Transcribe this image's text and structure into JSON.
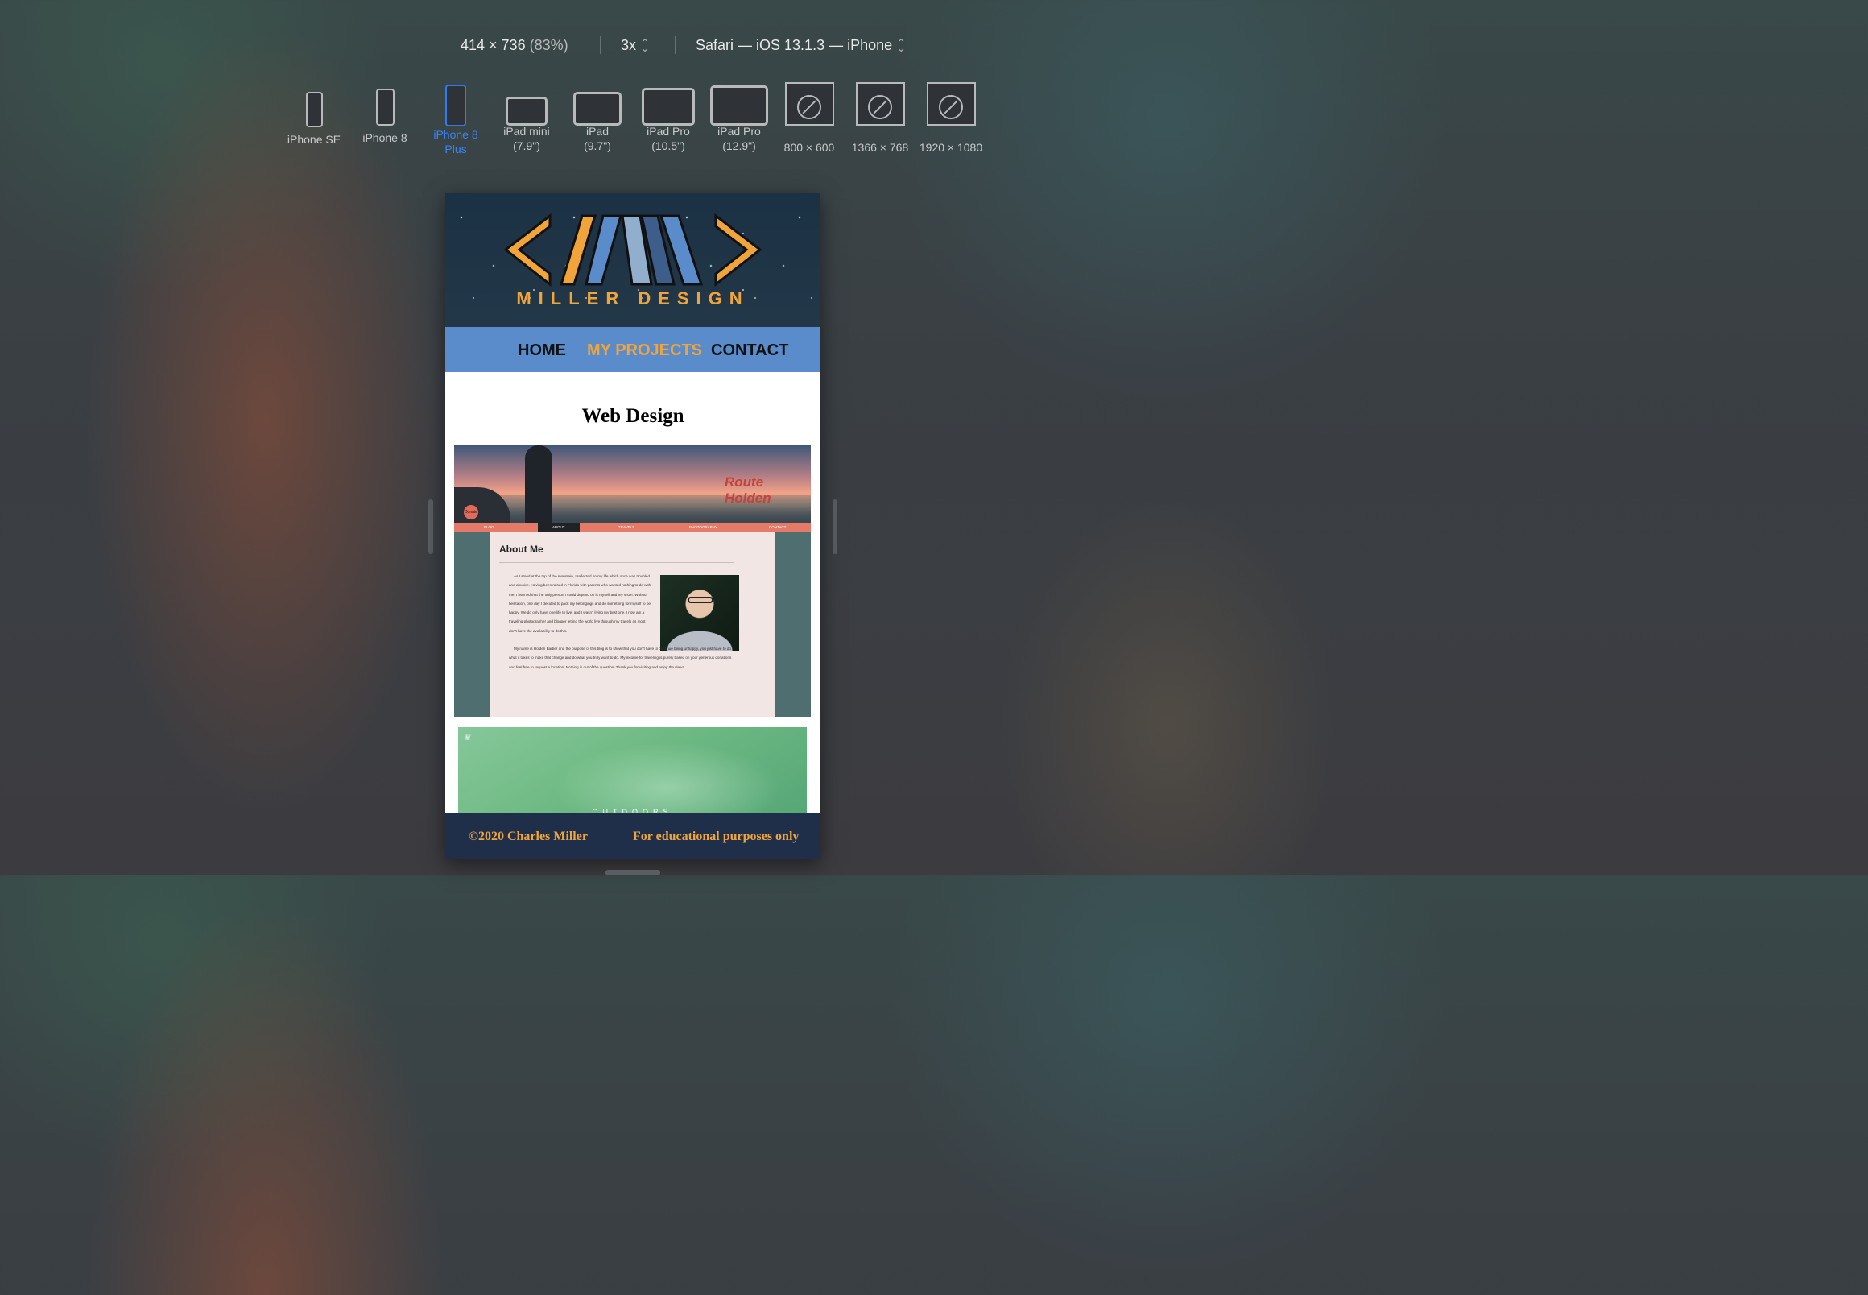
{
  "toolbar": {
    "dimensions": "414 × 736",
    "zoom": "(83%)",
    "scale": "3x",
    "browser": "Safari — iOS 13.1.3 — iPhone"
  },
  "devices": [
    {
      "label": "iPhone SE"
    },
    {
      "label": "iPhone 8"
    },
    {
      "label": "iPhone 8 Plus"
    },
    {
      "label": "iPad mini (7.9\")"
    },
    {
      "label": "iPad (9.7\")"
    },
    {
      "label": "iPad Pro (10.5\")"
    },
    {
      "label": "iPad Pro (12.9\")"
    },
    {
      "label": "800 × 600"
    },
    {
      "label": "1366 × 768"
    },
    {
      "label": "1920 × 1080"
    }
  ],
  "site": {
    "logo_text": "MILLER DESIGN",
    "nav": [
      "HOME",
      "MY PROJECTS",
      "CONTACT"
    ],
    "section_title": "Web Design",
    "footer_left": "©2020 Charles Miller",
    "footer_right": "For educational purposes only"
  },
  "project1": {
    "brand": "Route Holden",
    "donate": "Donate",
    "subnav": [
      "BLOG",
      "ABOUT",
      "TRAVELS",
      "PHOTOGRAPHY",
      "CONTACT"
    ],
    "heading": "About Me",
    "para1": "As I stood at the top of the mountain, I reflected on my life which once was troubled and abusive. Having been raised in Florida with parents who wanted nothing to do with me, I learned that the only person I could depend on is myself and my sister. Without hesitation, one day I decided to pack my belongings and do something for myself to be happy. We do only have one life to live, and I wasn't living my best one. I now am a traveling photographer and blogger letting the world live through my travels as most don't have the availability to do this.",
    "para2": "My name is Holden Barber and the purpose of this blog is to show that you don't have to continue being unhappy, you just have to do what it takes to make that change and do what you truly want to do. My income for traveling is purely based on your generous donations and feel free to request a location. Nothing is out of the question! Thank you for visiting and enjoy the view!"
  },
  "project2": {
    "caption": "OUTDOORS"
  },
  "colors": {
    "accent": "#f0a43a",
    "nav_bg": "#5a8bcb",
    "footer_bg": "#1f2f4a",
    "selected_device": "#3b82f6"
  }
}
